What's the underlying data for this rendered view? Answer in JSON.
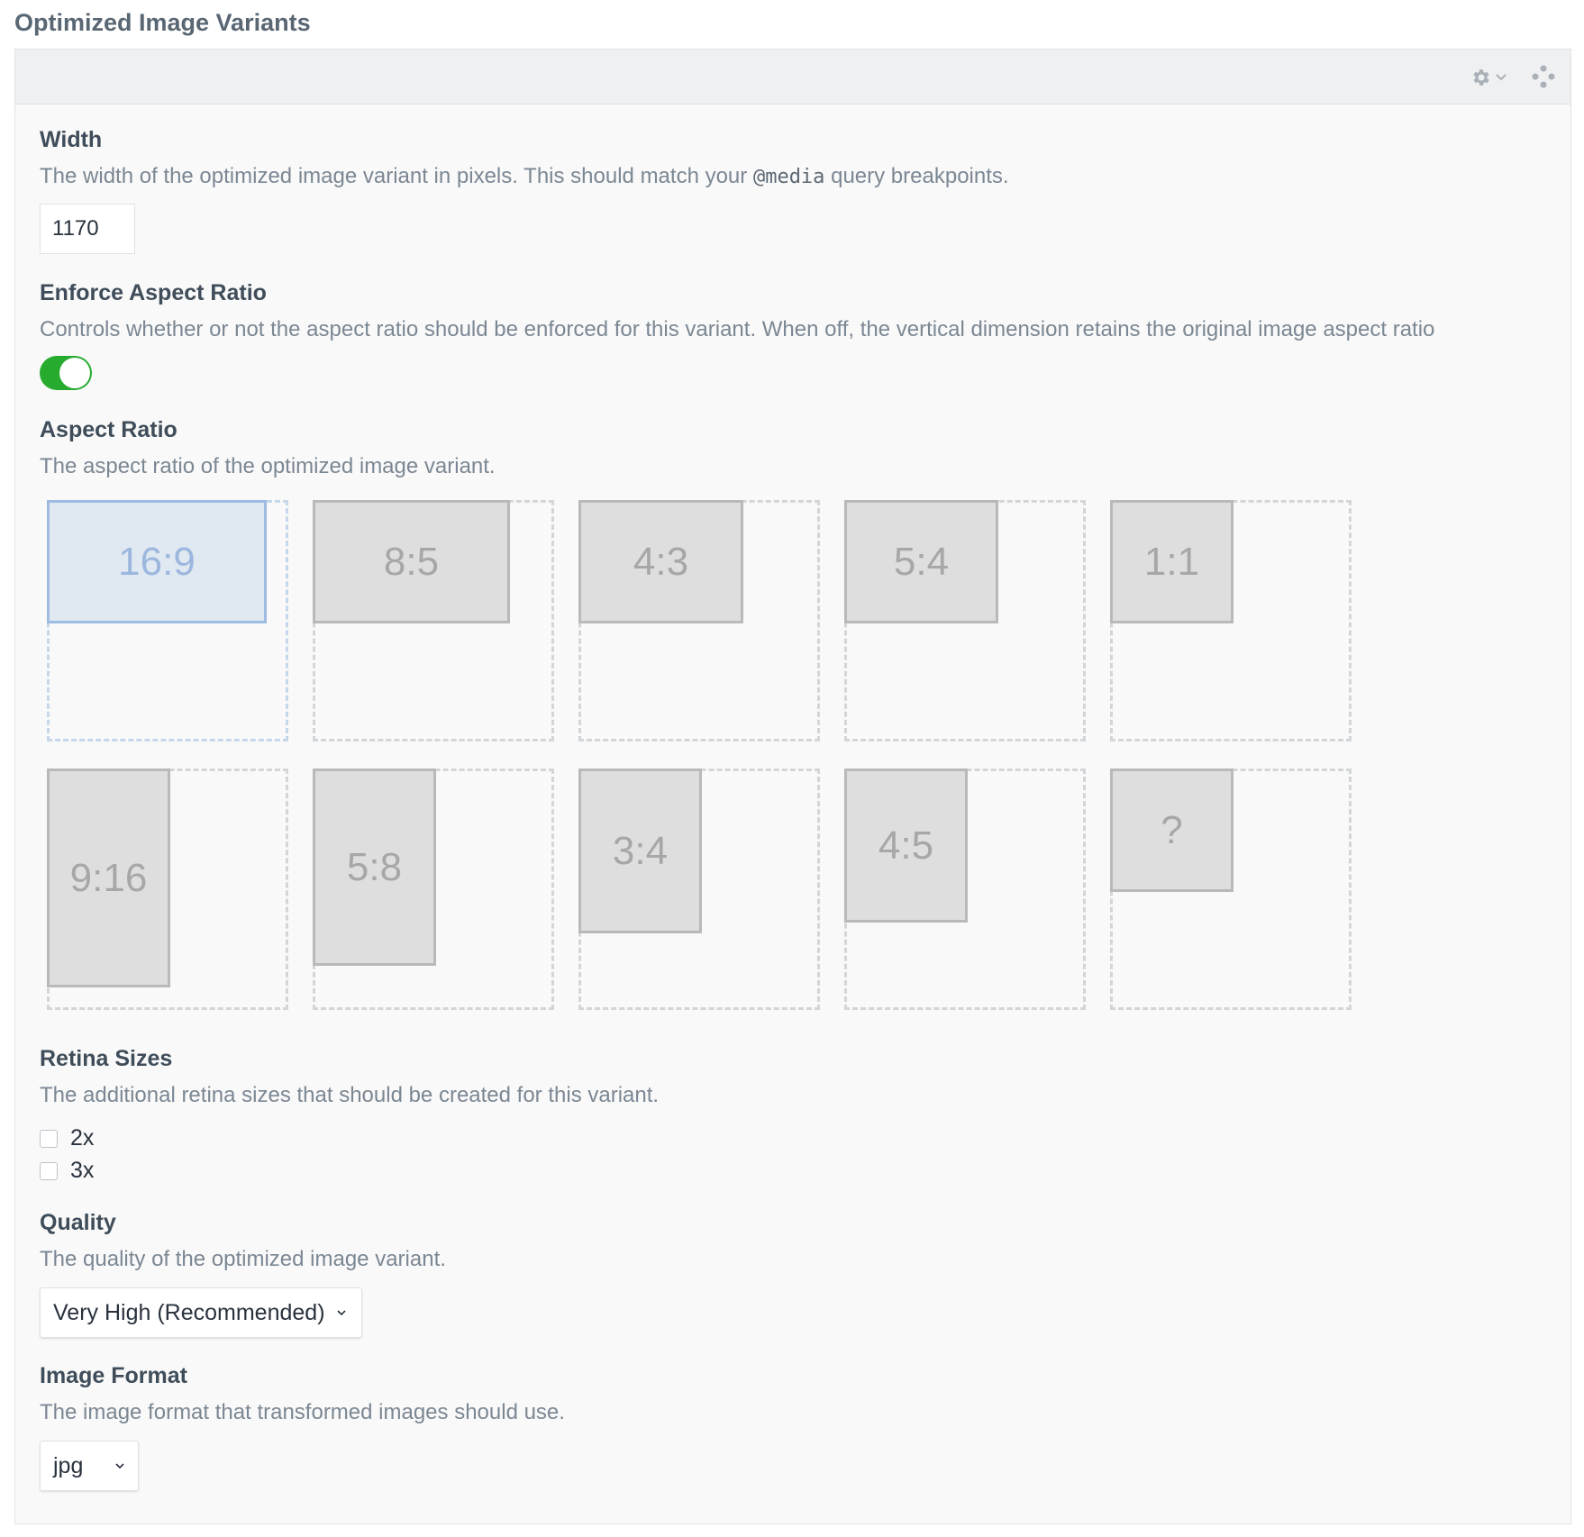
{
  "section_title": "Optimized Image Variants",
  "header": {
    "settings_icon": "gear-icon",
    "chevron_icon": "chevron-down-icon",
    "move_icon": "move-icon"
  },
  "width": {
    "label": "Width",
    "instructions_before": "The width of the optimized image variant in pixels. This should match your ",
    "instructions_code": "@media",
    "instructions_after": " query breakpoints.",
    "value": "1170"
  },
  "enforce": {
    "label": "Enforce Aspect Ratio",
    "instructions": "Controls whether or not the aspect ratio should be enforced for this variant. When off, the vertical dimension retains the original image aspect ratio",
    "on": true,
    "on_color": "#27ab2f"
  },
  "aspect_ratio": {
    "label": "Aspect Ratio",
    "instructions": "The aspect ratio of the optimized image variant.",
    "selected": "16:9",
    "options": [
      "16:9",
      "8:5",
      "4:3",
      "5:4",
      "1:1",
      "9:16",
      "5:8",
      "3:4",
      "4:5",
      "?"
    ]
  },
  "retina": {
    "label": "Retina Sizes",
    "instructions": "The additional retina sizes that should be created for this variant.",
    "options": [
      {
        "label": "2x",
        "checked": false
      },
      {
        "label": "3x",
        "checked": false
      }
    ]
  },
  "quality": {
    "label": "Quality",
    "instructions": "The quality of the optimized image variant.",
    "value": "Very High (Recommended)"
  },
  "format": {
    "label": "Image Format",
    "instructions": "The image format that transformed images should use.",
    "value": "jpg"
  }
}
